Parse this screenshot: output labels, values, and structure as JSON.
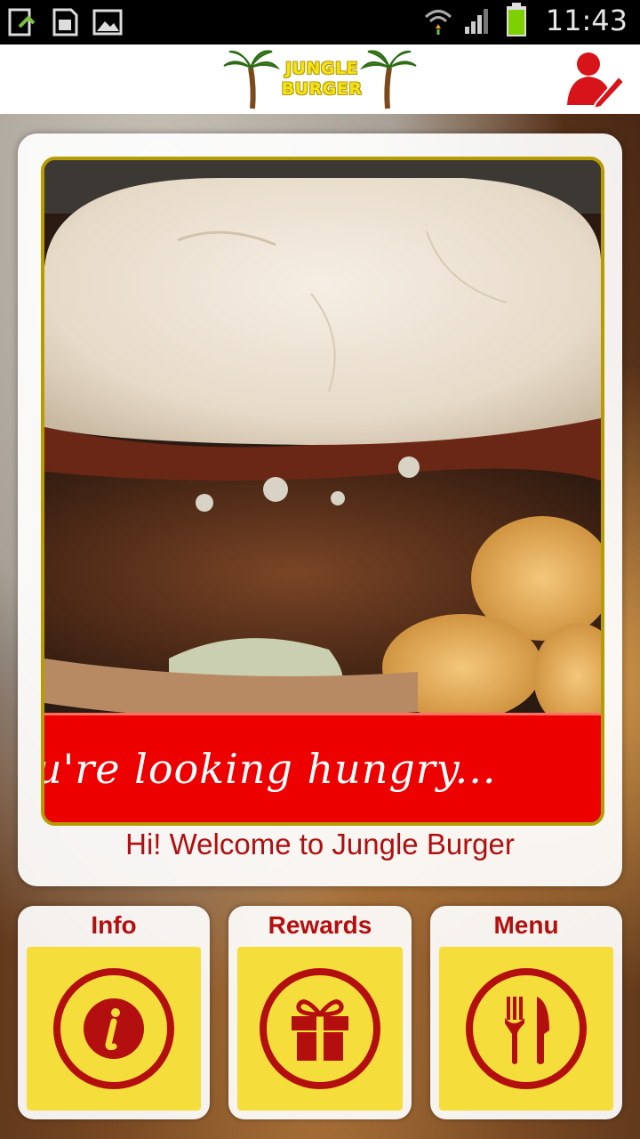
{
  "status_bar": {
    "time": "11:43",
    "icons": [
      "usb-debug-icon",
      "sim-storage-icon",
      "gallery-icon",
      "wifi-icon",
      "signal-icon",
      "battery-icon"
    ]
  },
  "header": {
    "logo_line1": "JUNGLE",
    "logo_line2": "BURGER",
    "profile_icon": "user-edit-icon"
  },
  "card": {
    "banner_text": "u're looking hungry...",
    "welcome_text": "Hi! Welcome to Jungle Burger"
  },
  "tiles": [
    {
      "label": "Info",
      "icon": "info-icon"
    },
    {
      "label": "Rewards",
      "icon": "gift-icon"
    },
    {
      "label": "Menu",
      "icon": "fork-knife-icon"
    }
  ],
  "colors": {
    "accent_red": "#b40f0f",
    "tile_yellow": "#f5de3c",
    "banner_red": "#ec0000"
  }
}
